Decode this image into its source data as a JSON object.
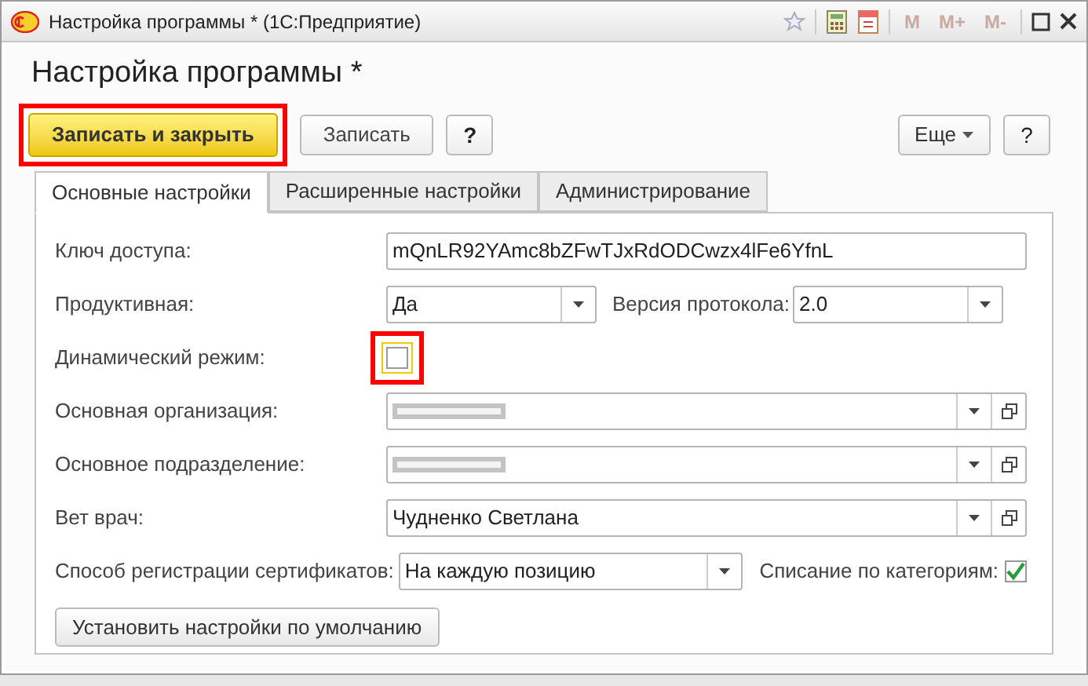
{
  "window": {
    "title": "Настройка программы * (1С:Предприятие)",
    "memory_buttons": [
      "M",
      "M+",
      "M-"
    ]
  },
  "form": {
    "title": "Настройка программы *"
  },
  "toolbar": [
    {
      "kind": "primary",
      "label": "Записать и закрыть",
      "highlighted": true
    },
    {
      "kind": "plain",
      "label": "Записать",
      "highlighted": false
    },
    {
      "kind": "help",
      "label": "?",
      "highlighted": false
    },
    {
      "kind": "menu",
      "label": "Еще",
      "highlighted": false
    },
    {
      "kind": "help_right",
      "label": "?",
      "highlighted": false
    }
  ],
  "tabs": [
    {
      "label": "Основные настройки",
      "selected": true
    },
    {
      "label": "Расширенные настройки",
      "selected": false
    },
    {
      "label": "Администрирование",
      "selected": false
    }
  ],
  "fields": [
    {
      "kind": "text",
      "label": "Ключ доступа:",
      "value": "mQnLR92YAmc8bZFwTJxRdODCwzx4lFe6YfnL"
    },
    {
      "kind": "combo_pair",
      "label": "Продуктивная:",
      "value": "Да",
      "label2": "Версия протокола:",
      "value2": "2.0"
    },
    {
      "kind": "checkbox",
      "label": "Динамический режим:",
      "checked": false,
      "highlighted": true
    },
    {
      "kind": "reference",
      "label": "Основная организация:",
      "redacted": true
    },
    {
      "kind": "reference",
      "label": "Основное подразделение:",
      "redacted": true
    },
    {
      "kind": "reference",
      "label": "Вет врач:",
      "value": "Чудненко Светлана"
    },
    {
      "kind": "combo_check",
      "label": "Способ регистрации сертификатов:",
      "value": "На каждую позицию",
      "check_label": "Списание по категориям:",
      "checked": true
    }
  ],
  "default_button": "Установить настройки по умолчанию"
}
